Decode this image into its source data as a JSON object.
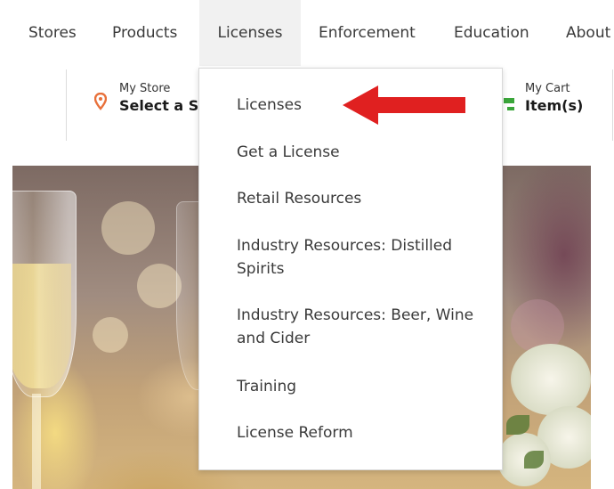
{
  "nav": {
    "items": [
      {
        "label": "Stores"
      },
      {
        "label": "Products"
      },
      {
        "label": "Licenses"
      },
      {
        "label": "Enforcement"
      },
      {
        "label": "Education"
      },
      {
        "label": "About"
      }
    ]
  },
  "store": {
    "small": "My Store",
    "big": "Select a St"
  },
  "cart": {
    "small": "My Cart",
    "big": "Item(s)"
  },
  "dropdown": {
    "items": [
      {
        "label": "Licenses"
      },
      {
        "label": "Get a License"
      },
      {
        "label": "Retail Resources"
      },
      {
        "label": "Industry Resources: Distilled Spirits"
      },
      {
        "label": "Industry Resources: Beer, Wine and Cider"
      },
      {
        "label": "Training"
      },
      {
        "label": "License Reform"
      }
    ]
  },
  "colors": {
    "pin": "#e8703a",
    "cart": "#3aa63a",
    "arrow": "#e02020"
  },
  "icons": [
    "location-pin-icon",
    "cart-icon",
    "red-arrow-annotation"
  ]
}
